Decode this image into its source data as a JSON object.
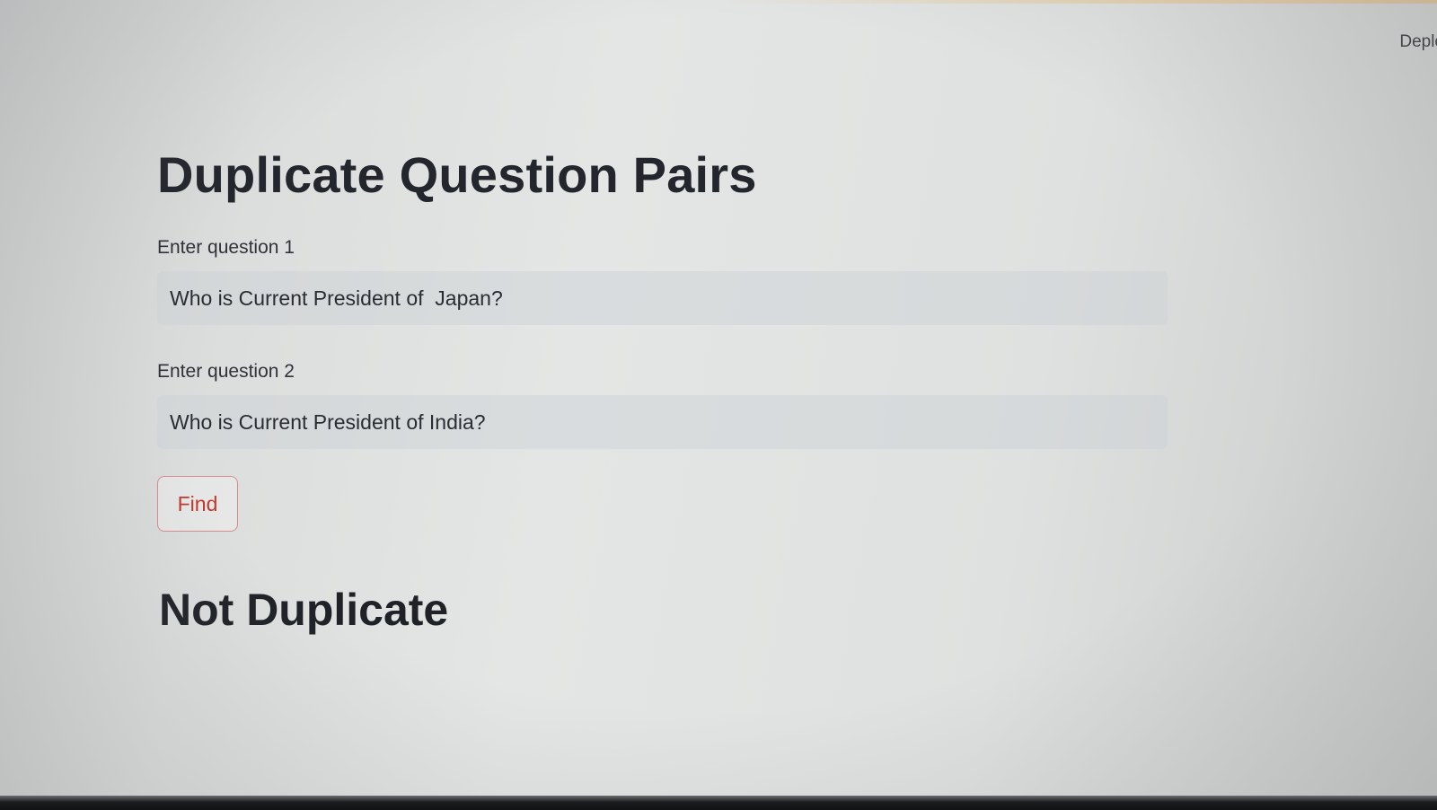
{
  "header": {
    "deploy_label": "Deplo"
  },
  "main": {
    "title": "Duplicate Question Pairs",
    "question1": {
      "label": "Enter question 1",
      "value": "Who is Current President of  Japan?"
    },
    "question2": {
      "label": "Enter question 2",
      "value": "Who is Current President of India?"
    },
    "find_label": "Find",
    "result": "Not Duplicate"
  },
  "colors": {
    "button_text": "#c0392b",
    "button_border": "#d98a8a",
    "heading": "#23262d"
  }
}
